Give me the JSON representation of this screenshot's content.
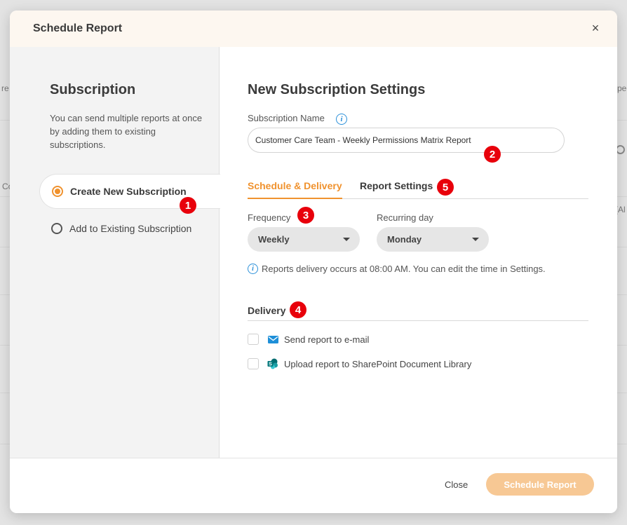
{
  "background": {
    "fragments": [
      "re",
      "Co",
      "pel",
      "(Al"
    ]
  },
  "modal": {
    "title": "Schedule Report",
    "close_glyph": "×"
  },
  "left": {
    "title": "Subscription",
    "description": "You can send multiple reports at once by adding them to existing subscriptions.",
    "options": [
      {
        "label": "Create New Subscription",
        "selected": true
      },
      {
        "label": "Add to Existing Subscription",
        "selected": false
      }
    ]
  },
  "right": {
    "title": "New Subscription Settings",
    "subscription_name_label": "Subscription Name",
    "subscription_name_value": "Customer Care Team - Weekly Permissions Matrix Report",
    "tabs": [
      {
        "label": "Schedule & Delivery",
        "active": true
      },
      {
        "label": "Report Settings",
        "active": false
      }
    ],
    "frequency_label": "Frequency",
    "frequency_value": "Weekly",
    "recurring_day_label": "Recurring day",
    "recurring_day_value": "Monday",
    "delivery_note": "Reports delivery occurs at 08:00 AM. You can edit the time in Settings.",
    "delivery_title": "Delivery",
    "delivery_options": [
      {
        "label": "Send report to e-mail",
        "icon": "email-icon",
        "checked": false
      },
      {
        "label": "Upload report to SharePoint Document Library",
        "icon": "sharepoint-icon",
        "checked": false
      }
    ]
  },
  "markers": [
    "1",
    "2",
    "3",
    "4",
    "5"
  ],
  "footer": {
    "close_label": "Close",
    "primary_label": "Schedule Report"
  },
  "colors": {
    "accent": "#f0922e",
    "primary_disabled": "#f7c894",
    "marker": "#e8000b",
    "info": "#2b90d9"
  }
}
